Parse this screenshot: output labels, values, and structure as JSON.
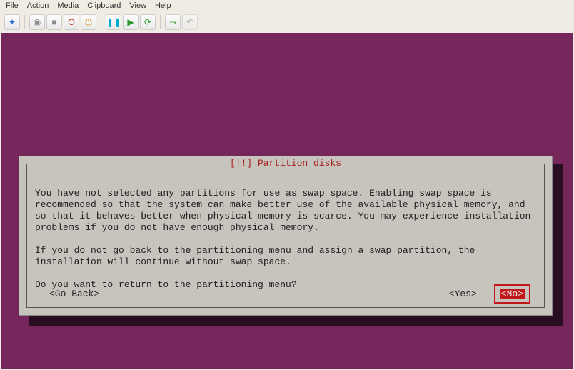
{
  "menubar": {
    "file": "File",
    "action": "Action",
    "media": "Media",
    "clipboard": "Clipboard",
    "view": "View",
    "help": "Help"
  },
  "toolbar": {
    "mascot": "mascot-icon",
    "record": "record-icon",
    "stop": "stop-icon",
    "shutdown": "shutdown-icon",
    "pause": "pause-icon",
    "play": "play-icon",
    "reset": "reset-icon",
    "checkpoint": "checkpoint-icon",
    "revert": "revert-icon"
  },
  "dialog": {
    "title": "[!!] Partition disks",
    "para1": "You have not selected any partitions for use as swap space. Enabling swap space is recommended so that the system can make better use of the available physical memory, and so that it behaves better when physical memory is scarce. You may experience installation problems if you do not have enough physical memory.",
    "para2": "If you do not go back to the partitioning menu and assign a swap partition, the installation will continue without swap space.",
    "question": "Do you want to return to the partitioning menu?",
    "go_back": "<Go Back>",
    "yes": "<Yes>",
    "no": "<No>"
  }
}
